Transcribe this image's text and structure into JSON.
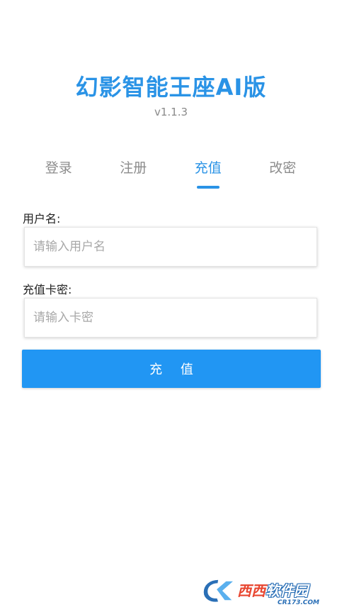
{
  "header": {
    "title": "幻影智能王座AI版",
    "version": "v1.1.3"
  },
  "tabs": [
    {
      "label": "登录",
      "active": false
    },
    {
      "label": "注册",
      "active": false
    },
    {
      "label": "充值",
      "active": true
    },
    {
      "label": "改密",
      "active": false
    }
  ],
  "form": {
    "username": {
      "label": "用户名:",
      "value": "",
      "placeholder": "请输入用户名"
    },
    "card_key": {
      "label": "充值卡密:",
      "value": "",
      "placeholder": "请输入卡密"
    },
    "submit_label": "充 值"
  },
  "watermark": {
    "text_red": "西西",
    "text_blue": "软件园",
    "sub": "CR173.COM"
  },
  "colors": {
    "accent": "#2a93e6",
    "button": "#2196f3",
    "tab_inactive": "#8c8c8c"
  }
}
